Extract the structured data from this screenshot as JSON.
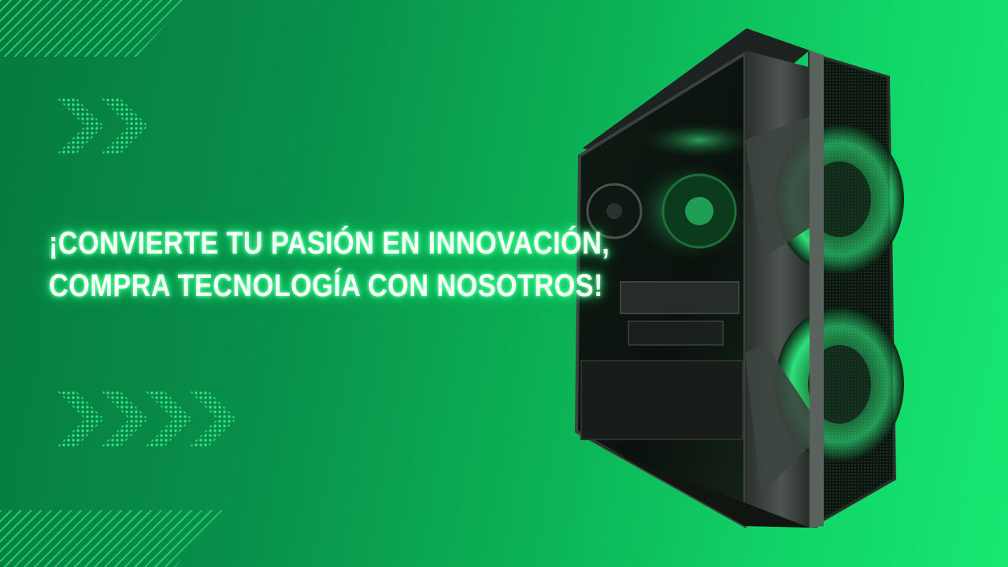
{
  "headline": {
    "line1": "¡Convierte tu pasión en innovación,",
    "line2": "compra tecnología con nosotros!"
  },
  "colors": {
    "background_start": "#067a3d",
    "background_end": "#17e872",
    "accent": "#2fe585",
    "text": "#f4fff7",
    "glow": "#2bff88"
  },
  "icons": {
    "decor_top": "diagonal-stripes",
    "decor_bottom": "diagonal-stripes",
    "arrows": "dotted-chevron-right"
  },
  "image": {
    "subject": "pc-gaming-case"
  }
}
